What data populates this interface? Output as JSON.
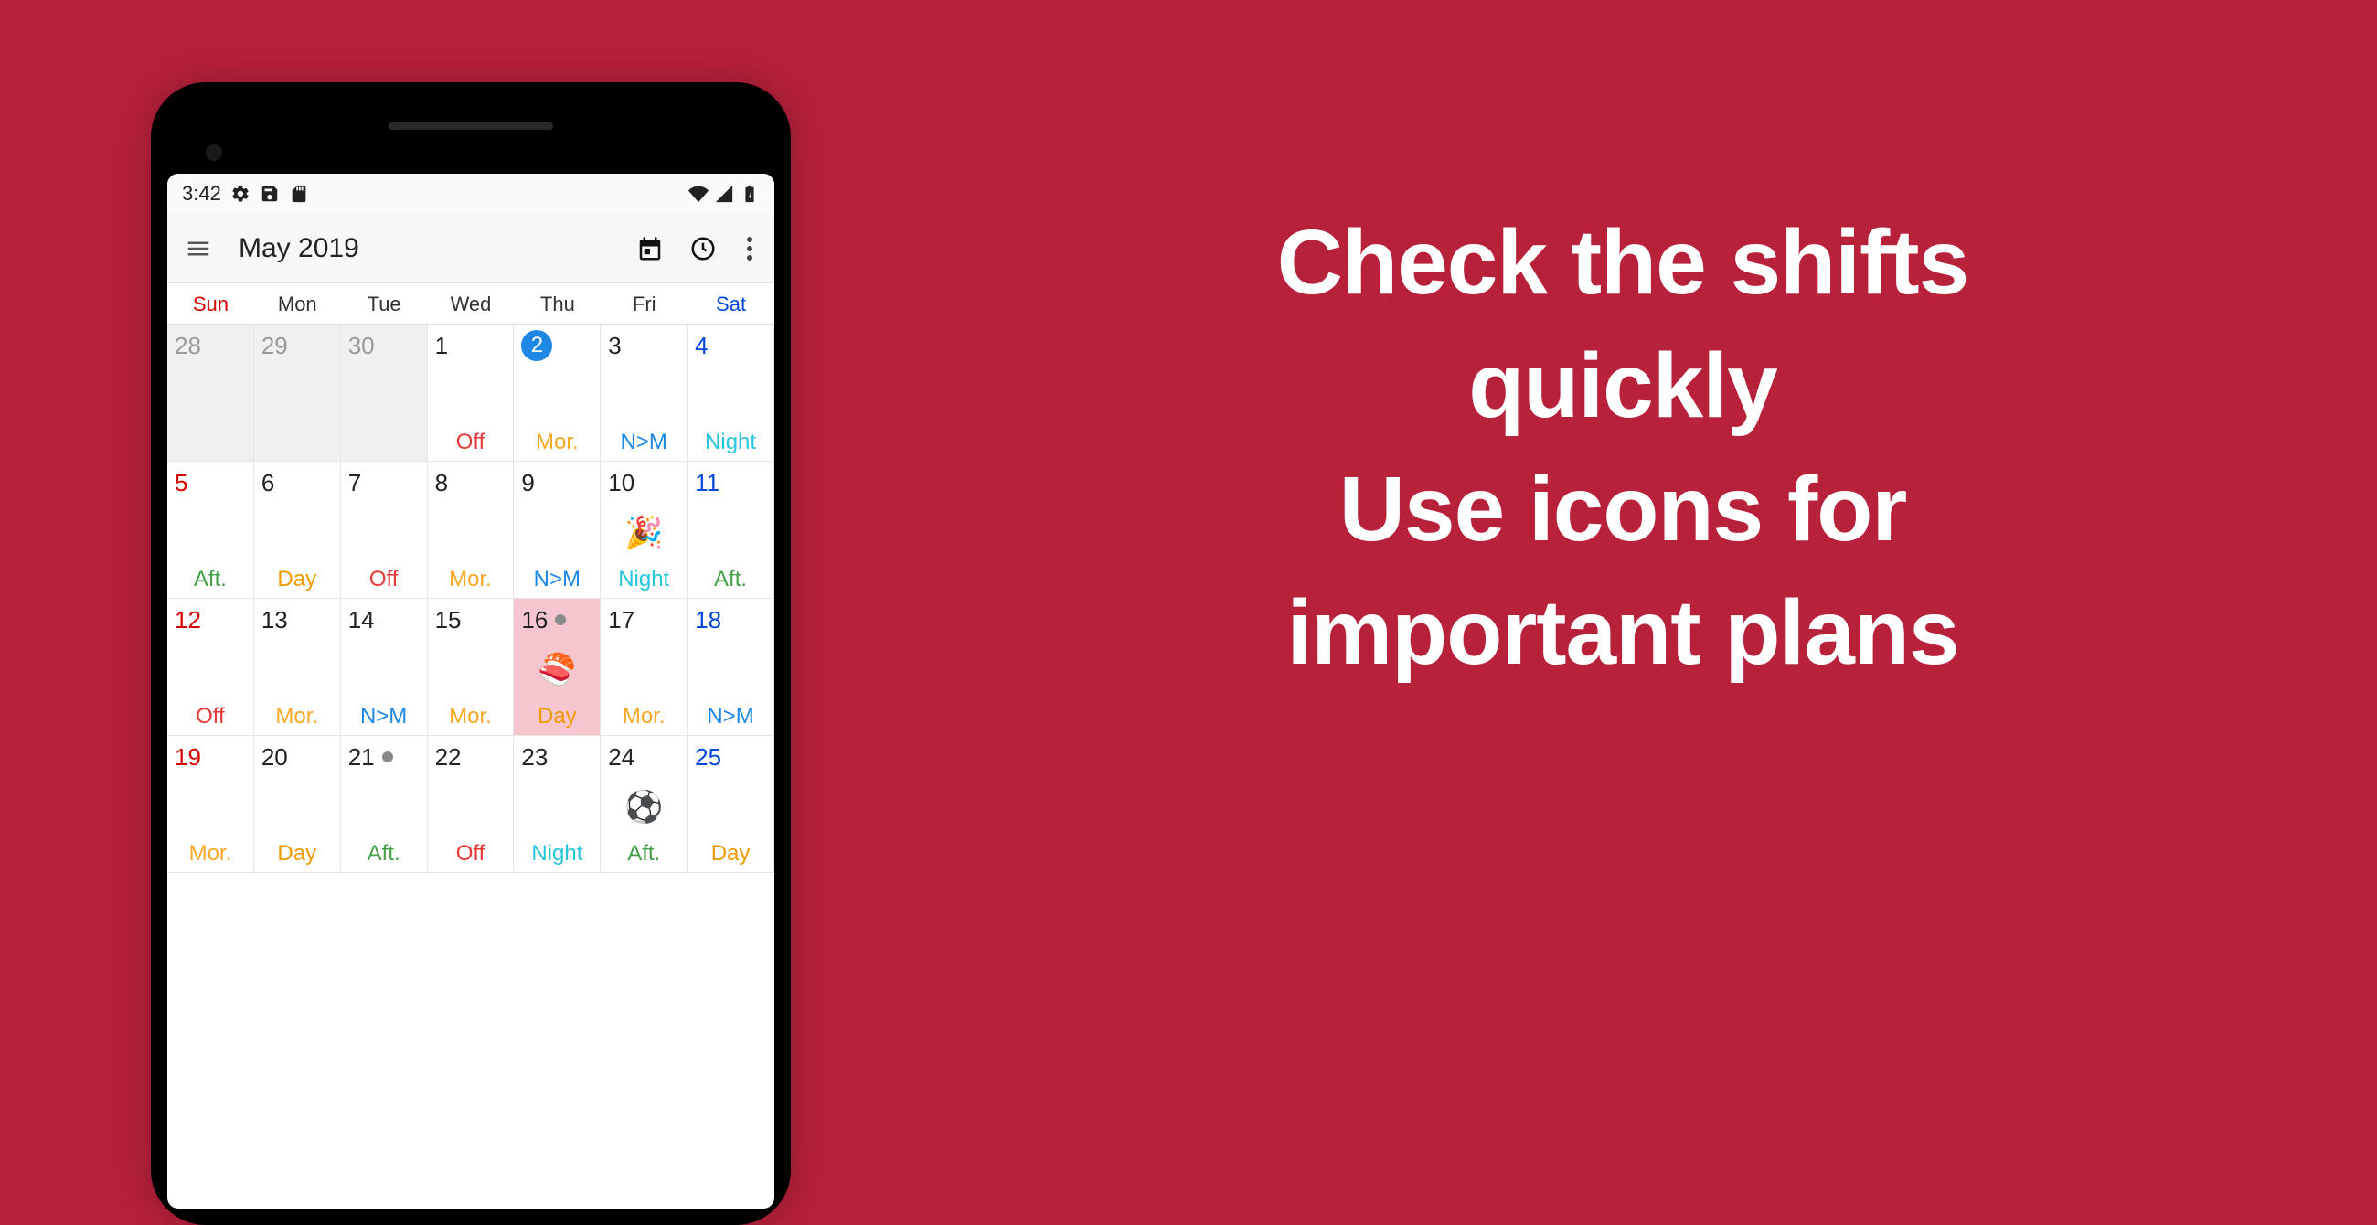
{
  "promo": {
    "line1": "Check the shifts",
    "line2": "quickly",
    "line3": "Use icons for",
    "line4": "important plans"
  },
  "statusbar": {
    "time": "3:42"
  },
  "appbar": {
    "title": "May 2019"
  },
  "dow": [
    "Sun",
    "Mon",
    "Tue",
    "Wed",
    "Thu",
    "Fri",
    "Sat"
  ],
  "shift_labels": {
    "off": "Off",
    "mor": "Mor.",
    "nm": "N>M",
    "night": "Night",
    "aft": "Aft.",
    "day": "Day"
  },
  "cells": [
    {
      "n": "28",
      "other": true
    },
    {
      "n": "29",
      "other": true
    },
    {
      "n": "30",
      "other": true
    },
    {
      "n": "1",
      "shift": "off"
    },
    {
      "n": "2",
      "shift": "mor",
      "today": true
    },
    {
      "n": "3",
      "shift": "nm"
    },
    {
      "n": "4",
      "shift": "night",
      "sat": true
    },
    {
      "n": "5",
      "shift": "aft",
      "sun": true
    },
    {
      "n": "6",
      "shift": "day"
    },
    {
      "n": "7",
      "shift": "off"
    },
    {
      "n": "8",
      "shift": "mor"
    },
    {
      "n": "9",
      "shift": "nm"
    },
    {
      "n": "10",
      "shift": "night",
      "emoji": "🎉"
    },
    {
      "n": "11",
      "shift": "aft",
      "sat": true
    },
    {
      "n": "12",
      "shift": "off",
      "sun": true
    },
    {
      "n": "13",
      "shift": "mor"
    },
    {
      "n": "14",
      "shift": "nm"
    },
    {
      "n": "15",
      "shift": "mor"
    },
    {
      "n": "16",
      "shift": "day",
      "emoji": "🍣",
      "hl": true,
      "dot": true
    },
    {
      "n": "17",
      "shift": "mor"
    },
    {
      "n": "18",
      "shift": "nm",
      "sat": true
    },
    {
      "n": "19",
      "shift": "mor",
      "sun": true
    },
    {
      "n": "20",
      "shift": "day"
    },
    {
      "n": "21",
      "shift": "aft",
      "dot": true
    },
    {
      "n": "22",
      "shift": "off"
    },
    {
      "n": "23",
      "shift": "night"
    },
    {
      "n": "24",
      "shift": "aft",
      "emoji": "⚽"
    },
    {
      "n": "25",
      "shift": "day",
      "sat": true
    }
  ]
}
